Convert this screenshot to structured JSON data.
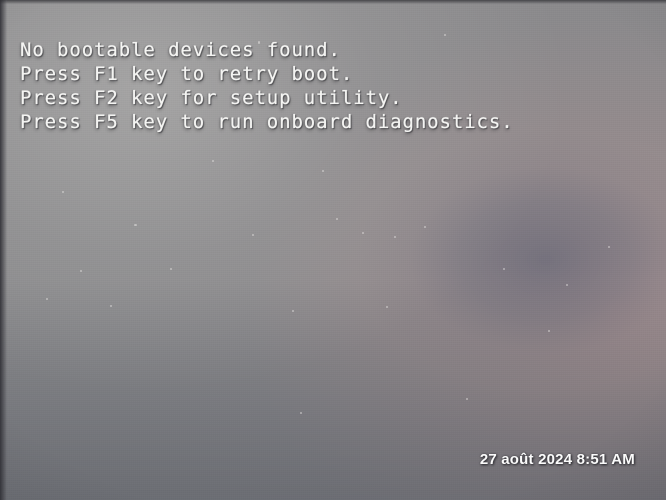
{
  "screen": {
    "kind": "bios-boot-error-screen",
    "background_color": "#8b8b8d",
    "text_color": "#f4f4f2",
    "shadow_tint": "#5c6072",
    "warm_tint": "#ad9292"
  },
  "bios": {
    "lines": [
      "No bootable devices found.",
      "Press F1 key to retry boot.",
      "Press F2 key for setup utility.",
      "Press F5 key to run onboard diagnostics."
    ],
    "line_1": "No bootable devices found.",
    "line_2": "Press F1 key to retry boot.",
    "line_3": "Press F2 key for setup utility.",
    "line_4": "Press F5 key to run onboard diagnostics.",
    "keys": [
      "F1",
      "F2",
      "F5"
    ]
  },
  "timestamp": {
    "text": "27 août 2024 8:51 AM",
    "day": "27",
    "month": "août",
    "year": "2024",
    "time": "8:51",
    "meridiem": "AM"
  }
}
